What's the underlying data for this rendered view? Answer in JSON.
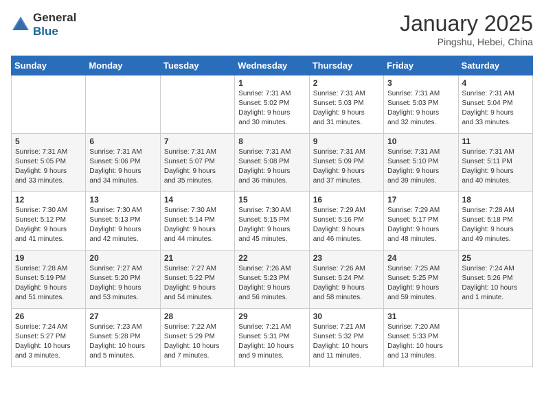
{
  "header": {
    "logo_general": "General",
    "logo_blue": "Blue",
    "month_title": "January 2025",
    "location": "Pingshu, Hebei, China"
  },
  "days_of_week": [
    "Sunday",
    "Monday",
    "Tuesday",
    "Wednesday",
    "Thursday",
    "Friday",
    "Saturday"
  ],
  "weeks": [
    [
      {
        "day": "",
        "info": ""
      },
      {
        "day": "",
        "info": ""
      },
      {
        "day": "",
        "info": ""
      },
      {
        "day": "1",
        "info": "Sunrise: 7:31 AM\nSunset: 5:02 PM\nDaylight: 9 hours\nand 30 minutes."
      },
      {
        "day": "2",
        "info": "Sunrise: 7:31 AM\nSunset: 5:03 PM\nDaylight: 9 hours\nand 31 minutes."
      },
      {
        "day": "3",
        "info": "Sunrise: 7:31 AM\nSunset: 5:03 PM\nDaylight: 9 hours\nand 32 minutes."
      },
      {
        "day": "4",
        "info": "Sunrise: 7:31 AM\nSunset: 5:04 PM\nDaylight: 9 hours\nand 33 minutes."
      }
    ],
    [
      {
        "day": "5",
        "info": "Sunrise: 7:31 AM\nSunset: 5:05 PM\nDaylight: 9 hours\nand 33 minutes."
      },
      {
        "day": "6",
        "info": "Sunrise: 7:31 AM\nSunset: 5:06 PM\nDaylight: 9 hours\nand 34 minutes."
      },
      {
        "day": "7",
        "info": "Sunrise: 7:31 AM\nSunset: 5:07 PM\nDaylight: 9 hours\nand 35 minutes."
      },
      {
        "day": "8",
        "info": "Sunrise: 7:31 AM\nSunset: 5:08 PM\nDaylight: 9 hours\nand 36 minutes."
      },
      {
        "day": "9",
        "info": "Sunrise: 7:31 AM\nSunset: 5:09 PM\nDaylight: 9 hours\nand 37 minutes."
      },
      {
        "day": "10",
        "info": "Sunrise: 7:31 AM\nSunset: 5:10 PM\nDaylight: 9 hours\nand 39 minutes."
      },
      {
        "day": "11",
        "info": "Sunrise: 7:31 AM\nSunset: 5:11 PM\nDaylight: 9 hours\nand 40 minutes."
      }
    ],
    [
      {
        "day": "12",
        "info": "Sunrise: 7:30 AM\nSunset: 5:12 PM\nDaylight: 9 hours\nand 41 minutes."
      },
      {
        "day": "13",
        "info": "Sunrise: 7:30 AM\nSunset: 5:13 PM\nDaylight: 9 hours\nand 42 minutes."
      },
      {
        "day": "14",
        "info": "Sunrise: 7:30 AM\nSunset: 5:14 PM\nDaylight: 9 hours\nand 44 minutes."
      },
      {
        "day": "15",
        "info": "Sunrise: 7:30 AM\nSunset: 5:15 PM\nDaylight: 9 hours\nand 45 minutes."
      },
      {
        "day": "16",
        "info": "Sunrise: 7:29 AM\nSunset: 5:16 PM\nDaylight: 9 hours\nand 46 minutes."
      },
      {
        "day": "17",
        "info": "Sunrise: 7:29 AM\nSunset: 5:17 PM\nDaylight: 9 hours\nand 48 minutes."
      },
      {
        "day": "18",
        "info": "Sunrise: 7:28 AM\nSunset: 5:18 PM\nDaylight: 9 hours\nand 49 minutes."
      }
    ],
    [
      {
        "day": "19",
        "info": "Sunrise: 7:28 AM\nSunset: 5:19 PM\nDaylight: 9 hours\nand 51 minutes."
      },
      {
        "day": "20",
        "info": "Sunrise: 7:27 AM\nSunset: 5:20 PM\nDaylight: 9 hours\nand 53 minutes."
      },
      {
        "day": "21",
        "info": "Sunrise: 7:27 AM\nSunset: 5:22 PM\nDaylight: 9 hours\nand 54 minutes."
      },
      {
        "day": "22",
        "info": "Sunrise: 7:26 AM\nSunset: 5:23 PM\nDaylight: 9 hours\nand 56 minutes."
      },
      {
        "day": "23",
        "info": "Sunrise: 7:26 AM\nSunset: 5:24 PM\nDaylight: 9 hours\nand 58 minutes."
      },
      {
        "day": "24",
        "info": "Sunrise: 7:25 AM\nSunset: 5:25 PM\nDaylight: 9 hours\nand 59 minutes."
      },
      {
        "day": "25",
        "info": "Sunrise: 7:24 AM\nSunset: 5:26 PM\nDaylight: 10 hours\nand 1 minute."
      }
    ],
    [
      {
        "day": "26",
        "info": "Sunrise: 7:24 AM\nSunset: 5:27 PM\nDaylight: 10 hours\nand 3 minutes."
      },
      {
        "day": "27",
        "info": "Sunrise: 7:23 AM\nSunset: 5:28 PM\nDaylight: 10 hours\nand 5 minutes."
      },
      {
        "day": "28",
        "info": "Sunrise: 7:22 AM\nSunset: 5:29 PM\nDaylight: 10 hours\nand 7 minutes."
      },
      {
        "day": "29",
        "info": "Sunrise: 7:21 AM\nSunset: 5:31 PM\nDaylight: 10 hours\nand 9 minutes."
      },
      {
        "day": "30",
        "info": "Sunrise: 7:21 AM\nSunset: 5:32 PM\nDaylight: 10 hours\nand 11 minutes."
      },
      {
        "day": "31",
        "info": "Sunrise: 7:20 AM\nSunset: 5:33 PM\nDaylight: 10 hours\nand 13 minutes."
      },
      {
        "day": "",
        "info": ""
      }
    ]
  ]
}
